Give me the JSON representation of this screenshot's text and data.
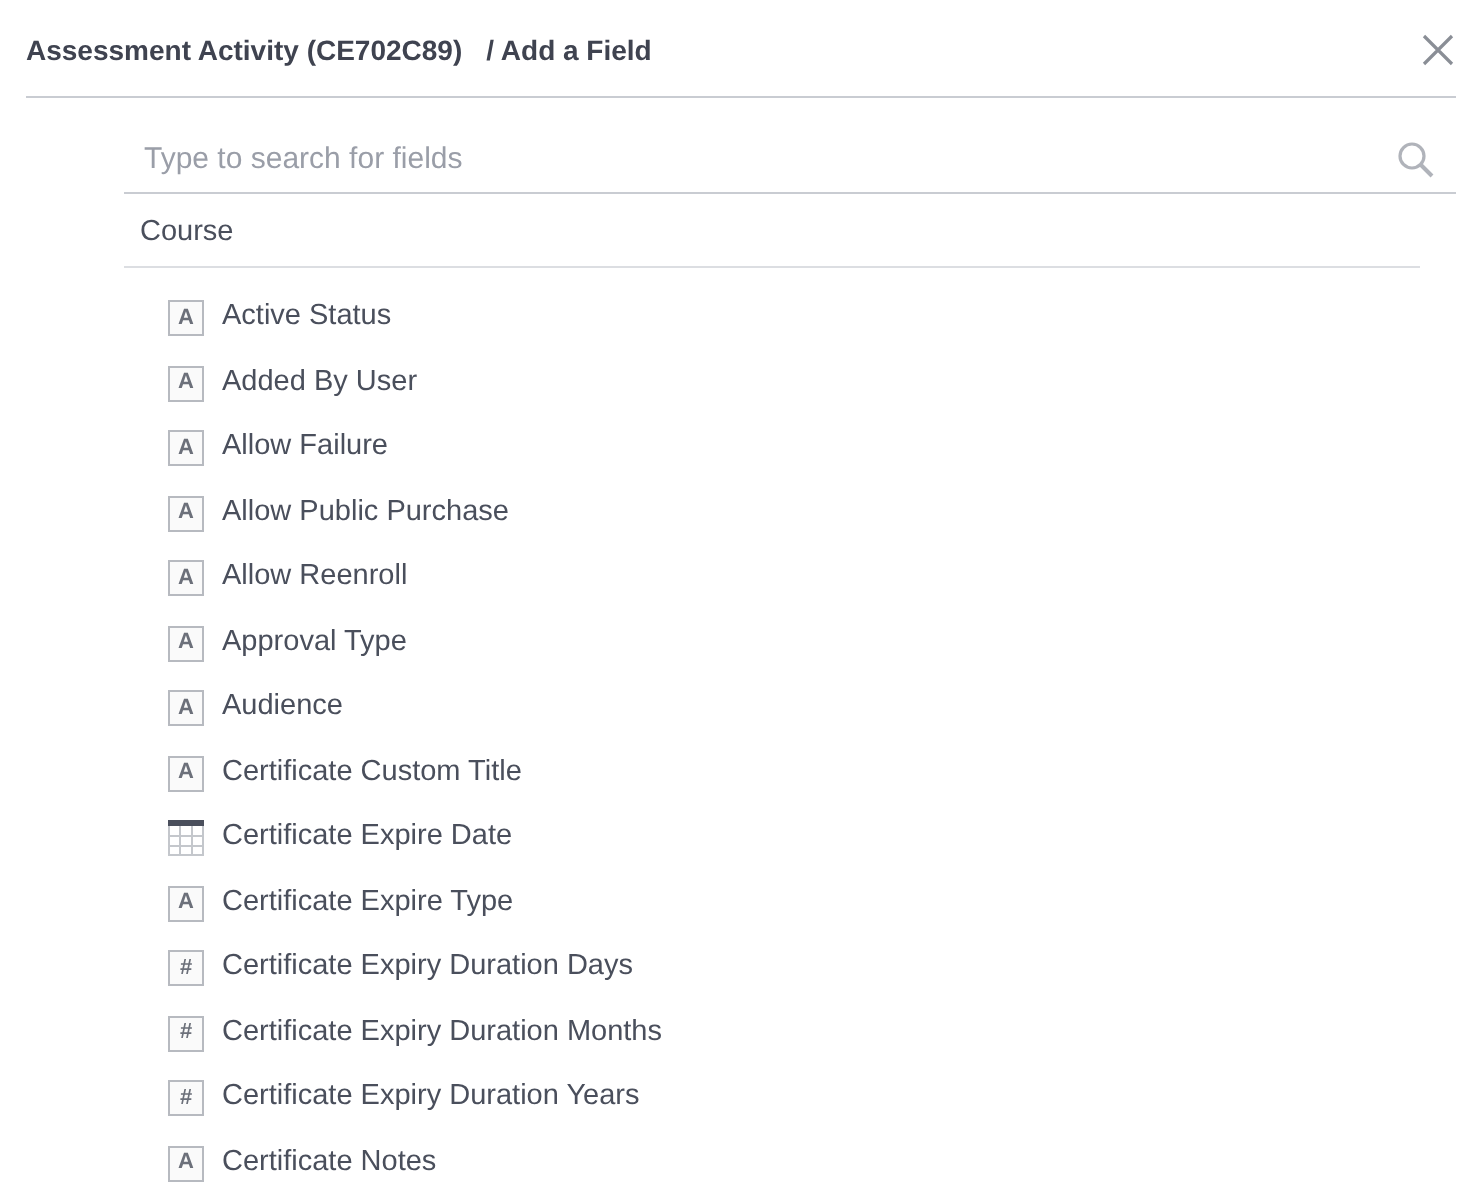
{
  "header": {
    "title": "Assessment Activity (CE702C89)",
    "subtitle": "/ Add a Field"
  },
  "search": {
    "placeholder": "Type to search for fields"
  },
  "group": {
    "label": "Course"
  },
  "fields": [
    {
      "label": "Active Status",
      "kind": "text",
      "glyph": "A"
    },
    {
      "label": "Added By User",
      "kind": "text",
      "glyph": "A"
    },
    {
      "label": "Allow Failure",
      "kind": "text",
      "glyph": "A"
    },
    {
      "label": "Allow Public Purchase",
      "kind": "text",
      "glyph": "A"
    },
    {
      "label": "Allow Reenroll",
      "kind": "text",
      "glyph": "A"
    },
    {
      "label": "Approval Type",
      "kind": "text",
      "glyph": "A"
    },
    {
      "label": "Audience",
      "kind": "text",
      "glyph": "A"
    },
    {
      "label": "Certificate Custom Title",
      "kind": "text",
      "glyph": "A"
    },
    {
      "label": "Certificate Expire Date",
      "kind": "date"
    },
    {
      "label": "Certificate Expire Type",
      "kind": "text",
      "glyph": "A"
    },
    {
      "label": "Certificate Expiry Duration Days",
      "kind": "number",
      "glyph": "#"
    },
    {
      "label": "Certificate Expiry Duration Months",
      "kind": "number",
      "glyph": "#"
    },
    {
      "label": "Certificate Expiry Duration Years",
      "kind": "number",
      "glyph": "#"
    },
    {
      "label": "Certificate Notes",
      "kind": "text",
      "glyph": "A"
    }
  ]
}
